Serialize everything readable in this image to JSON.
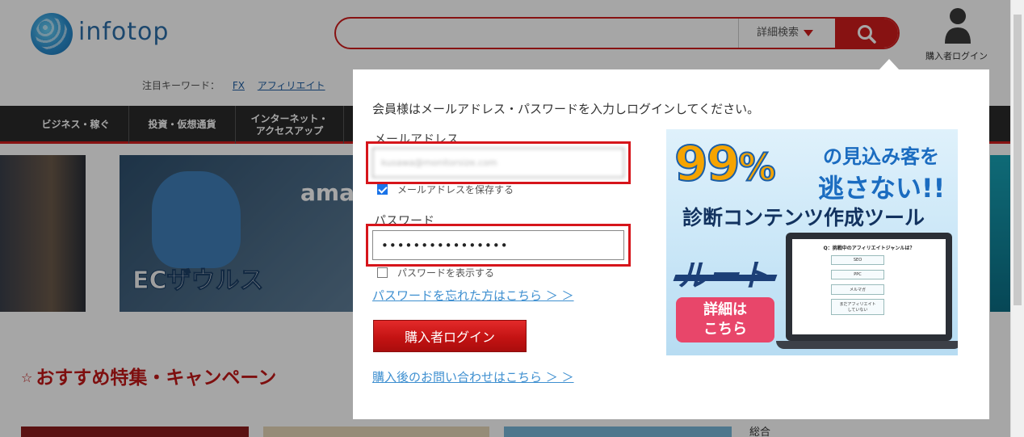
{
  "header": {
    "logo_text": "infotop",
    "search_placeholder": "",
    "search_detail_label": "詳細検索",
    "buyer_login_label": "購入者ログイン"
  },
  "keywords": {
    "label": "注目キーワード：",
    "items": [
      "FX",
      "アフィリエイト"
    ]
  },
  "nav": {
    "items": [
      "ビジネス・稼ぐ",
      "投資・仮想通貨",
      "インターネット・\nアクセスアップ"
    ]
  },
  "banners": {
    "ama_text": "ama",
    "ec_label": "ECザウルス"
  },
  "section": {
    "star": "☆",
    "title": "おすすめ特集・キャンペーン"
  },
  "side_label": "総合",
  "login": {
    "intro": "会員様はメールアドレス・パスワードを入力しログインしてください。",
    "email_label": "メールアドレス",
    "email_value": "kusawa@monitorsize.com",
    "remember_email_label": "メールアドレスを保存する",
    "remember_email_checked": true,
    "password_label": "パスワード",
    "password_value": "••••••••••••••••",
    "show_password_label": "パスワードを表示する",
    "show_password_checked": false,
    "forgot_link": "パスワードを忘れた方はこちら ＞ ＞",
    "login_button": "購入者ログイン",
    "contact_link": "購入後のお問い合わせはこちら ＞ ＞"
  },
  "ad": {
    "big_number": "99",
    "percent": "%",
    "line1": "の見込み客を",
    "line2": "逃さない!!",
    "subtitle": "診断コンテンツ作成ツール",
    "brand": "ルート",
    "detail_button": "詳細は\nこちら",
    "survey_question": "Q：挑戦中のアフィリエイトジャンルは？",
    "survey_options": [
      "SEO",
      "PPC",
      "メルマガ",
      "まだアフィリエイト\nしていない"
    ]
  },
  "colors": {
    "accent": "#d01d1d",
    "highlight": "#d6151b",
    "link": "#3e8fd0"
  }
}
